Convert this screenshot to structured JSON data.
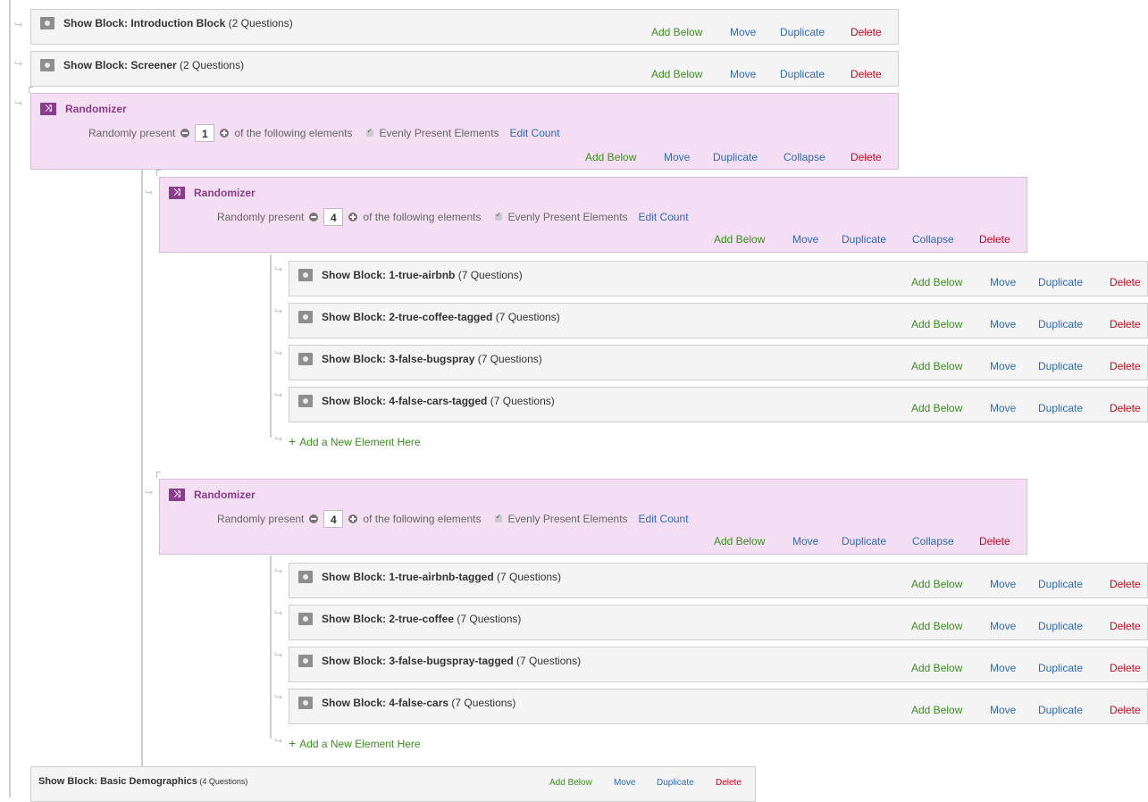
{
  "actions": {
    "add_below": "Add Below",
    "move": "Move",
    "duplicate": "Duplicate",
    "collapse": "Collapse",
    "delete": "Delete"
  },
  "top_blocks": [
    {
      "prefix": "Show Block: ",
      "name": "Introduction Block",
      "count": " (2 Questions)"
    },
    {
      "prefix": "Show Block: ",
      "name": "Screener",
      "count": " (2 Questions)"
    }
  ],
  "randomizer_outer": {
    "title": "Randomizer",
    "randomly_present": "Randomly present",
    "count": "1",
    "following": "of the following elements",
    "evenly": "Evenly Present Elements",
    "edit_count": "Edit Count"
  },
  "randomizer_a": {
    "title": "Randomizer",
    "randomly_present": "Randomly present",
    "count": "4",
    "following": "of the following elements",
    "evenly": "Evenly Present Elements",
    "edit_count": "Edit Count",
    "blocks": [
      {
        "prefix": "Show Block: ",
        "name": "1-true-airbnb",
        "count": " (7 Questions)"
      },
      {
        "prefix": "Show Block: ",
        "name": "2-true-coffee-tagged",
        "count": " (7 Questions)"
      },
      {
        "prefix": "Show Block: ",
        "name": "3-false-bugspray",
        "count": " (7 Questions)"
      },
      {
        "prefix": "Show Block: ",
        "name": "4-false-cars-tagged",
        "count": " (7 Questions)"
      }
    ],
    "add_new": "Add a New Element Here"
  },
  "randomizer_b": {
    "title": "Randomizer",
    "randomly_present": "Randomly present",
    "count": "4",
    "following": "of the following elements",
    "evenly": "Evenly Present Elements",
    "edit_count": "Edit Count",
    "blocks": [
      {
        "prefix": "Show Block: ",
        "name": "1-true-airbnb-tagged",
        "count": " (7 Questions)"
      },
      {
        "prefix": "Show Block: ",
        "name": "2-true-coffee",
        "count": " (7 Questions)"
      },
      {
        "prefix": "Show Block: ",
        "name": "3-false-bugspray-tagged",
        "count": " (7 Questions)"
      },
      {
        "prefix": "Show Block: ",
        "name": "4-false-cars",
        "count": " (7 Questions)"
      }
    ],
    "add_new": "Add a New Element Here"
  },
  "bottom_block": {
    "prefix": "Show Block: ",
    "name": "Basic Demographics",
    "count": " (4 Questions)"
  }
}
